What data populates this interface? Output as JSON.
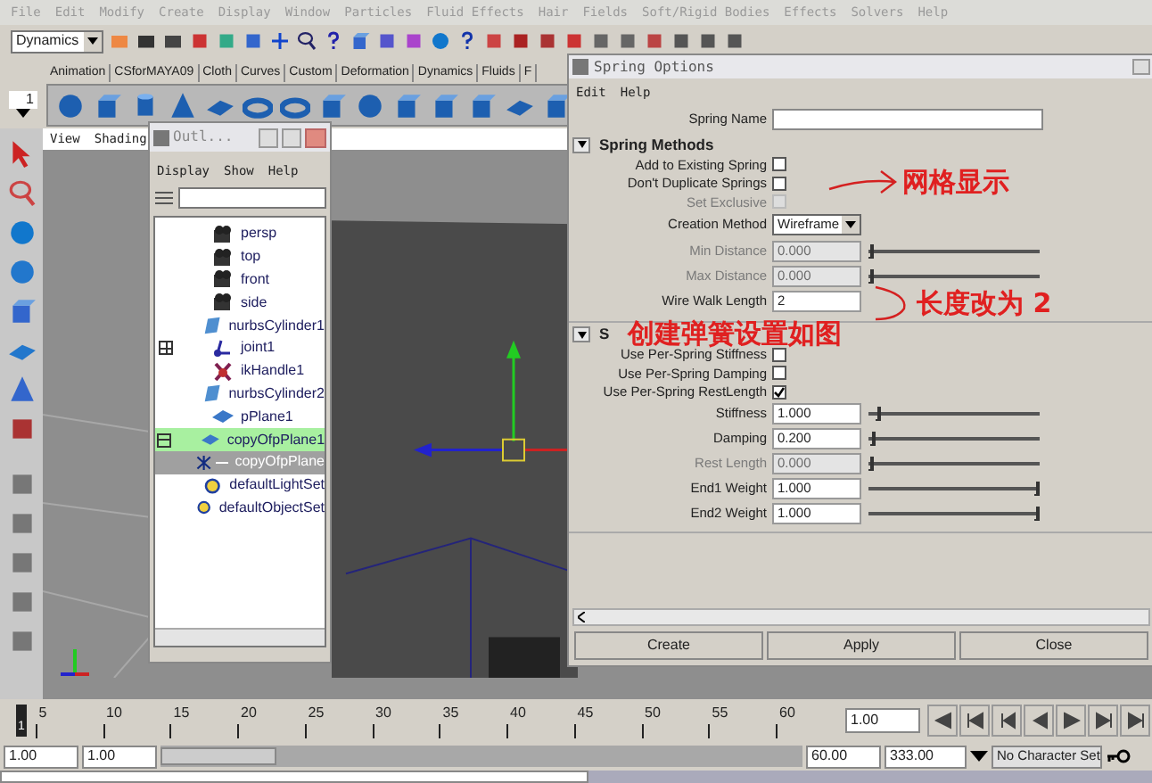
{
  "menu_bar": [
    "File",
    "Edit",
    "Modify",
    "Create",
    "Display",
    "Window",
    "Particles",
    "Fluid Effects",
    "Hair",
    "Fields",
    "Soft/Rigid Bodies",
    "Effects",
    "Solvers",
    "Help"
  ],
  "status_line": {
    "mode": "Dynamics"
  },
  "shelf_tabs": [
    "Animation",
    "CSforMAYA09",
    "Cloth",
    "Curves",
    "Custom",
    "Deformation",
    "Dynamics",
    "Fluids",
    "F"
  ],
  "shelf_counter": "1",
  "viewport": {
    "menu": [
      "View",
      "Shading"
    ]
  },
  "outliner": {
    "title": "Outl...",
    "menu": [
      "Display",
      "Show",
      "Help"
    ],
    "items": [
      {
        "label": "persp",
        "kind": "camera",
        "selected": false
      },
      {
        "label": "top",
        "kind": "camera",
        "selected": false
      },
      {
        "label": "front",
        "kind": "camera",
        "selected": false
      },
      {
        "label": "side",
        "kind": "camera",
        "selected": false
      },
      {
        "label": "nurbsCylinder1",
        "kind": "surface",
        "selected": false
      },
      {
        "label": "joint1",
        "kind": "joint",
        "selected": false,
        "expanded": false
      },
      {
        "label": "ikHandle1",
        "kind": "ik",
        "selected": false
      },
      {
        "label": "nurbsCylinder2",
        "kind": "surface",
        "selected": false
      },
      {
        "label": "pPlane1",
        "kind": "mesh",
        "selected": false
      },
      {
        "label": "copyOfpPlane1",
        "kind": "mesh",
        "selected": true,
        "expanded": true,
        "children": [
          {
            "label": "copyOfpPlane",
            "kind": "spring",
            "selected": false
          }
        ]
      },
      {
        "label": "defaultLightSet",
        "kind": "set",
        "selected": false
      },
      {
        "label": "defaultObjectSet",
        "kind": "set",
        "selected": false
      }
    ]
  },
  "spring_options": {
    "title": "Spring Options",
    "menu": [
      "Edit",
      "Help"
    ],
    "spring_name": {
      "label": "Spring Name"
    },
    "sections": [
      {
        "title": "Spring Methods",
        "expanded": true,
        "rows": [
          {
            "kind": "checkbox",
            "label": "Add to Existing Spring",
            "checked": false,
            "disabled": false
          },
          {
            "kind": "checkbox",
            "label": "Don't Duplicate Springs",
            "checked": false,
            "disabled": false
          },
          {
            "kind": "checkbox",
            "label": "Set Exclusive",
            "checked": false,
            "disabled": true
          },
          {
            "kind": "dropdown",
            "label": "Creation Method",
            "value": "Wireframe"
          },
          {
            "kind": "slider",
            "label": "Min Distance",
            "value": "0.000",
            "level": 0.0,
            "disabled": true
          },
          {
            "kind": "slider",
            "label": "Max Distance",
            "value": "0.000",
            "level": 0.0,
            "disabled": true
          },
          {
            "kind": "field",
            "label": "Wire Walk Length",
            "value": "2"
          }
        ]
      },
      {
        "title": "S",
        "expanded": true,
        "rows": [
          {
            "kind": "checkbox",
            "label": "Use Per-Spring Stiffness",
            "checked": false,
            "disabled": false
          },
          {
            "kind": "checkbox",
            "label": "Use Per-Spring Damping",
            "checked": false,
            "disabled": false
          },
          {
            "kind": "checkbox",
            "label": "Use Per-Spring RestLength",
            "checked": true,
            "disabled": false
          },
          {
            "kind": "slider",
            "label": "Stiffness",
            "value": "1.000",
            "level": 0.04,
            "disabled": false
          },
          {
            "kind": "slider",
            "label": "Damping",
            "value": "0.200",
            "level": 0.01,
            "disabled": false
          },
          {
            "kind": "slider",
            "label": "Rest Length",
            "value": "0.000",
            "level": 0.0,
            "disabled": true
          },
          {
            "kind": "slider",
            "label": "End1 Weight",
            "value": "1.000",
            "level": 1.0,
            "disabled": false
          },
          {
            "kind": "slider",
            "label": "End2 Weight",
            "value": "1.000",
            "level": 1.0,
            "disabled": false
          }
        ]
      }
    ],
    "buttons": [
      "Create",
      "Apply",
      "Close"
    ]
  },
  "annotations": [
    "网格显示",
    "长度改为 2",
    "创建弹簧设置如图"
  ],
  "time_slider": {
    "current": "1",
    "level": 0.0,
    "ticks": [
      "5",
      "10",
      "15",
      "20",
      "25",
      "30",
      "35",
      "40",
      "45",
      "50",
      "55",
      "60"
    ],
    "current_time": "1.00"
  },
  "range_slider": {
    "level": 0.18,
    "start": "1.00",
    "playback_start": "1.00",
    "playback_end": "60.00",
    "end": "333.00"
  },
  "character_set": "No Character Set"
}
